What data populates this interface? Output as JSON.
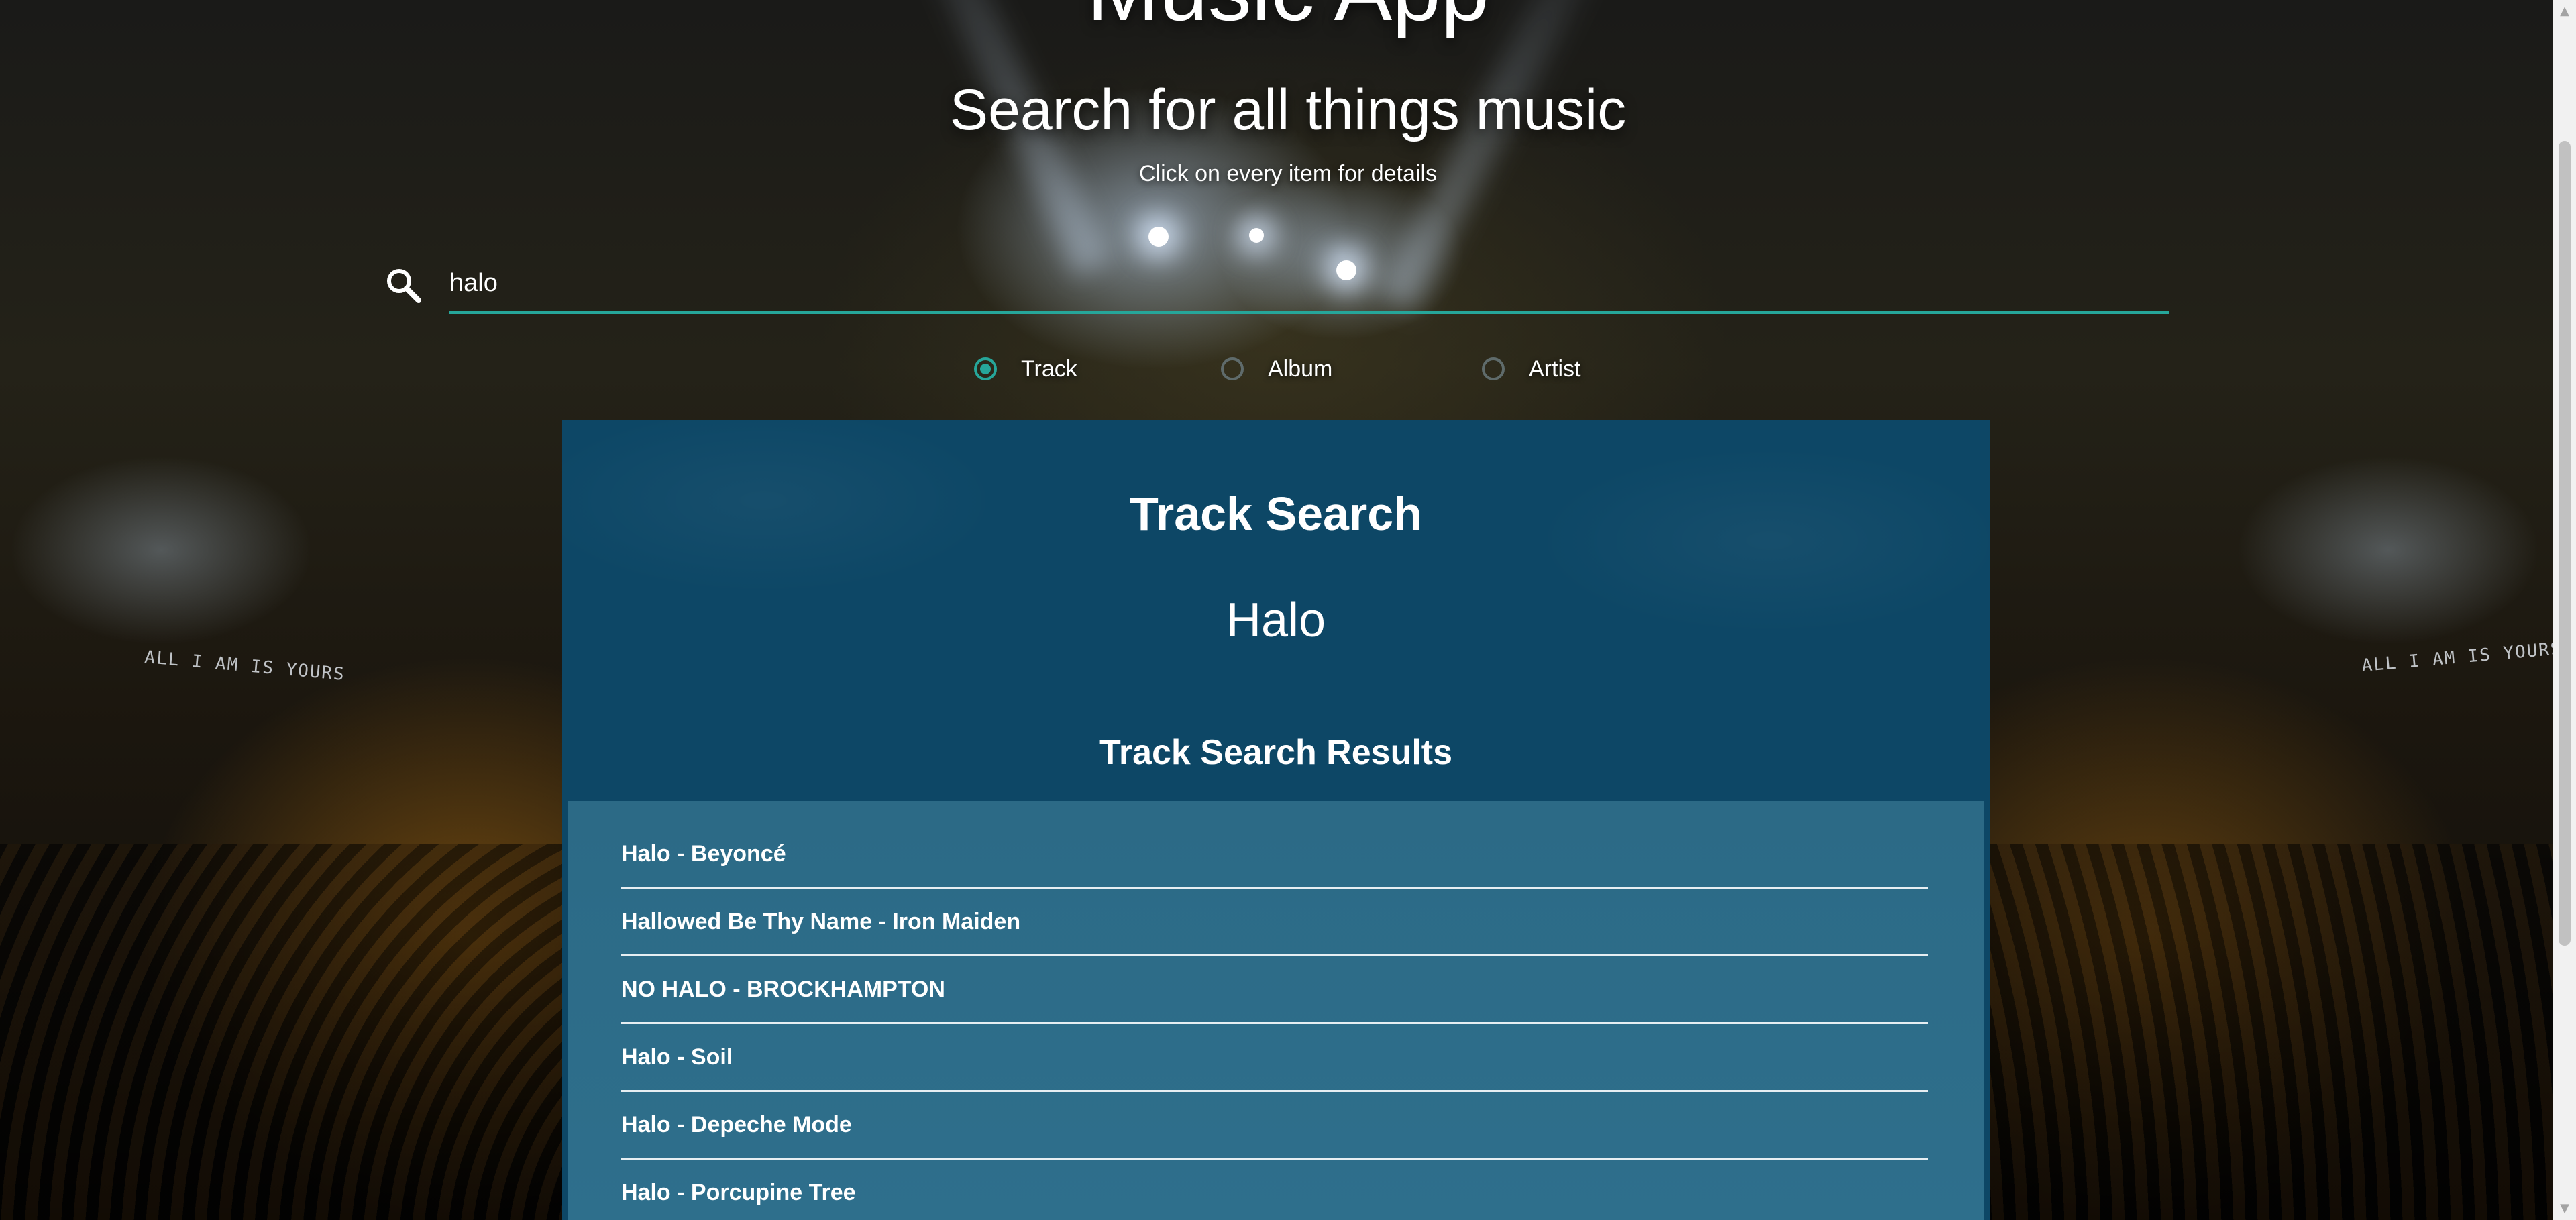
{
  "header": {
    "app_title": "Music App",
    "title": "Search for all things music",
    "subtitle": "Click on every item for details"
  },
  "search": {
    "value": "halo",
    "icon": "search-icon"
  },
  "search_type": {
    "options": [
      {
        "label": "Track",
        "checked": true
      },
      {
        "label": "Album",
        "checked": false
      },
      {
        "label": "Artist",
        "checked": false
      }
    ]
  },
  "background": {
    "screen_text_left": "ALL I AM IS YOURS",
    "screen_text_right": "ALL I AM IS YOURS"
  },
  "panel": {
    "title": "Track Search",
    "query": "Halo",
    "results_title": "Track Search Results",
    "results": [
      "Halo - Beyoncé",
      "Hallowed Be Thy Name - Iron Maiden",
      "NO HALO - BROCKHAMPTON",
      "Halo - Soil",
      "Halo - Depeche Mode",
      "Halo - Porcupine Tree"
    ]
  },
  "colors": {
    "accent": "#26a69a",
    "panel": "#0d4766",
    "results_bg": "#2c6a86"
  }
}
